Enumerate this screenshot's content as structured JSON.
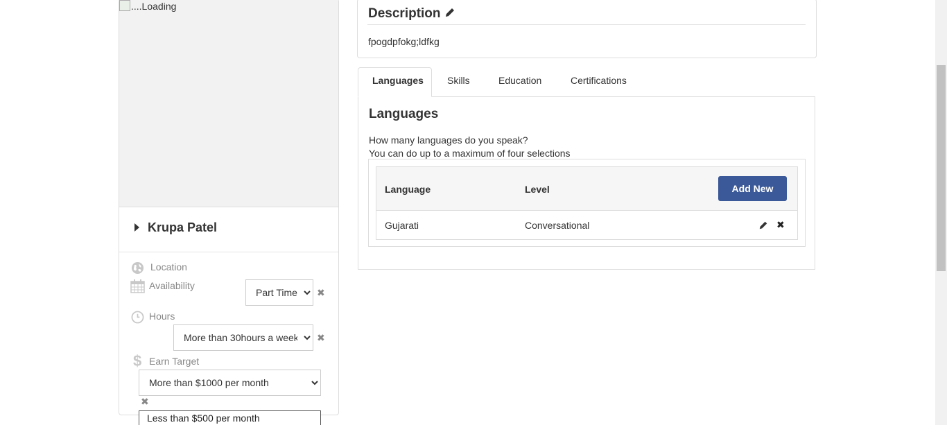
{
  "profile": {
    "image_alt": "....Loading",
    "name": "Krupa Patel",
    "location_label": "Location",
    "availability_label": "Availability",
    "availability_value": "Part Time",
    "availability_options": [
      "Part Time"
    ],
    "hours_label": "Hours",
    "hours_value": "More than 30hours a week",
    "hours_options": [
      "More than 30hours a week"
    ],
    "earn_label": "Earn Target",
    "earn_value": "More than $1000 per month",
    "earn_options": [
      "More than $1000 per month"
    ],
    "earn_dropdown_visible_option": "Less than $500 per month"
  },
  "description": {
    "title": "Description",
    "text": "fpogdpfokg;ldfkg"
  },
  "tabs": [
    {
      "label": "Languages",
      "active": true
    },
    {
      "label": "Skills",
      "active": false
    },
    {
      "label": "Education",
      "active": false
    },
    {
      "label": "Certifications",
      "active": false
    }
  ],
  "languages": {
    "title": "Languages",
    "question": "How many languages do you speak?",
    "hint": "You can do up to a maximum of four selections",
    "columns": [
      "Language",
      "Level"
    ],
    "add_button": "Add New",
    "rows": [
      {
        "language": "Gujarati",
        "level": "Conversational"
      }
    ]
  },
  "icons": {
    "location": "globe-icon",
    "availability": "calendar-icon",
    "hours": "clock-icon",
    "earn": "dollar-icon",
    "description_edit": "pencil-icon",
    "row_edit": "pencil-icon",
    "row_delete": "close-icon"
  },
  "colors": {
    "primary_button": "#3b5998",
    "muted_label": "#888888"
  }
}
